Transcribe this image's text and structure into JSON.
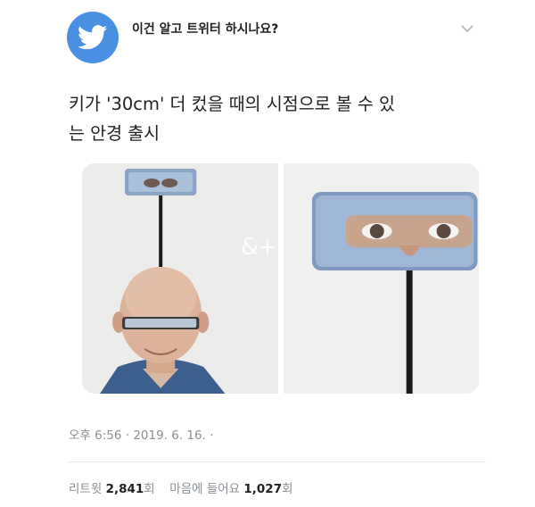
{
  "header": {
    "author_name": "이건 알고 트위터 하시나요?",
    "avatar_icon": "twitter-bird-icon",
    "menu_icon": "chevron-down-icon",
    "brand_color": "#4a90e2"
  },
  "tweet": {
    "text_line1": "키가 '30cm' 더 컸을 때의 시점으로 볼 수 있",
    "text_line2": "는 안경 출시"
  },
  "media": {
    "watermark": "&+"
  },
  "meta": {
    "timestamp": "오후 6:56 · 2019. 6. 16. ·"
  },
  "stats": {
    "retweet_label": "리트윗",
    "retweet_count": "2,841",
    "retweet_unit": "회",
    "like_label": "마음에 들어요",
    "like_count": "1,027",
    "like_unit": "회"
  }
}
